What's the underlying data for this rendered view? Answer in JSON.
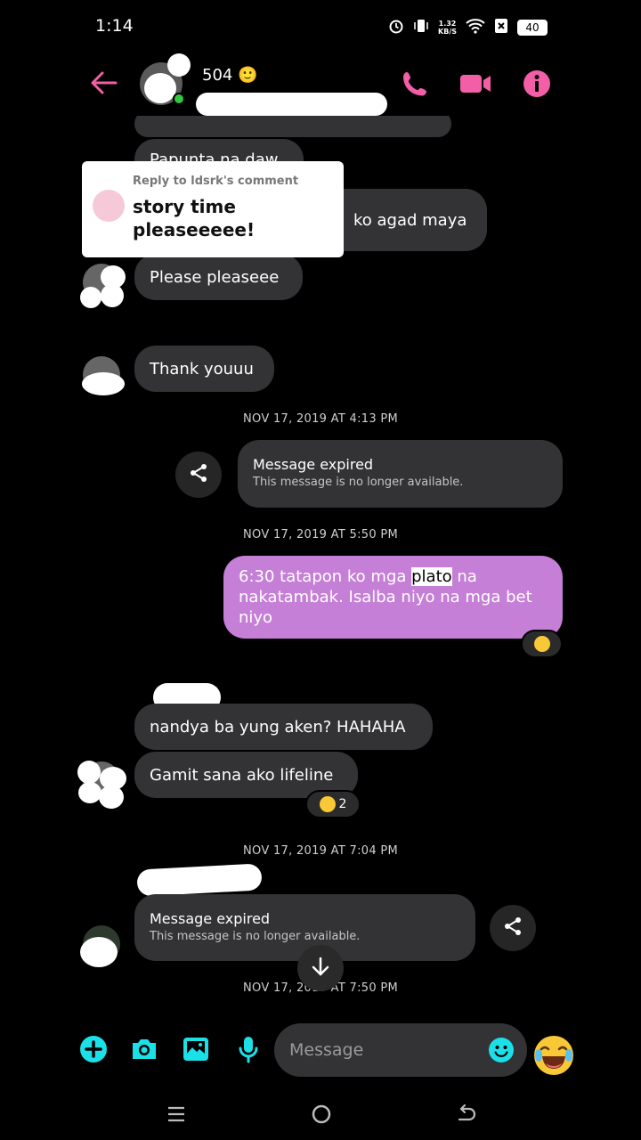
{
  "status": {
    "time": "1:14",
    "net_speed_value": "1.32",
    "net_speed_unit": "KB/S",
    "battery": "40"
  },
  "header": {
    "contact_name": "504 🙂"
  },
  "messages": {
    "partial_1": "Papunta na daw",
    "partial_2": "ko agad maya",
    "please": "Please pleaseee",
    "thank_you": "Thank youuu",
    "timestamp_1": "NOV 17, 2019 AT 4:13 PM",
    "expired_1_title": "Message expired",
    "expired_1_sub": "This message is no longer available.",
    "timestamp_2": "NOV 17, 2019 AT 5:50 PM",
    "me_text_pre": "6:30 tatapon ko mga ",
    "me_text_highlight": "plato",
    "me_text_post": " na nakatambak. Isalba niyo na mga bet niyo",
    "nandya": "nandya ba yung aken? HAHAHA",
    "gamit": "Gamit sana ako lifeline",
    "reaction_count": "2",
    "timestamp_3": "NOV 17, 2019 AT 7:04 PM",
    "expired_2_title": "Message expired",
    "expired_2_sub": "This message is no longer available.",
    "timestamp_4": "NOV 17, 2019 AT 7:50 PM"
  },
  "reply_card": {
    "label": "Reply to ldsrk's comment",
    "quote_line1": "story time",
    "quote_line2": "pleaseeeee!"
  },
  "composer": {
    "placeholder": "Message"
  },
  "colors": {
    "accent_pink": "#f25fa6",
    "accent_cyan": "#1ce0e8",
    "my_bubble": "#c57fd6",
    "their_bubble": "#333336"
  }
}
